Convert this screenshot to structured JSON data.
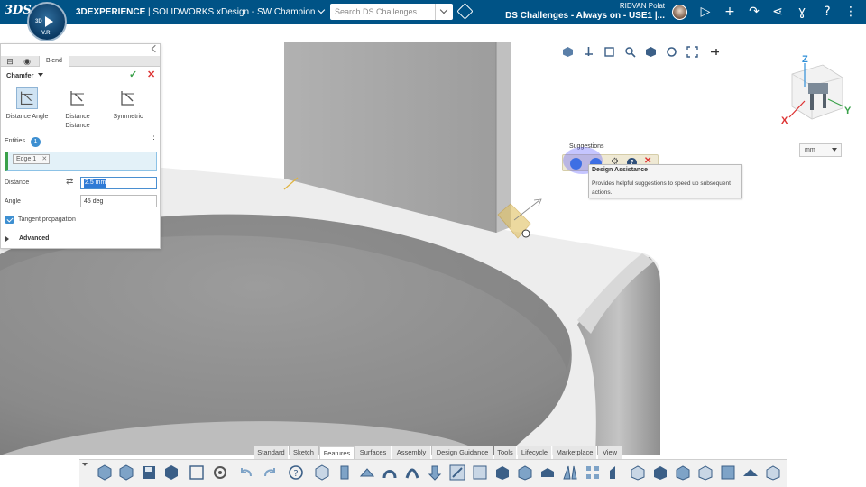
{
  "topbar": {
    "logo_text": "3DS",
    "compass_labels": [
      "3D",
      "V.R"
    ],
    "app_title_brand": "3DEXPERIENCE",
    "app_title_rest": " | SOLIDWORKS xDesign - SW Champion",
    "search_placeholder": "Search DS Challenges",
    "user_name": "RIDVAN Polat",
    "platform_title": "DS Challenges - Always on - USE1 |...",
    "icons": [
      "share-icon",
      "add-icon",
      "forward-icon",
      "network-icon",
      "compass-apps-icon",
      "help-icon",
      "more-icon"
    ]
  },
  "panel": {
    "tab_label": "Blend",
    "feature_name": "Chamfer",
    "types": [
      {
        "label": "Distance Angle",
        "selected": true
      },
      {
        "label": "Distance Distance",
        "selected": false
      },
      {
        "label": "Symmetric",
        "selected": false
      }
    ],
    "entities_label": "Entities",
    "entities_count": "1",
    "entity_chip": "Edge.1",
    "distance_label": "Distance",
    "distance_value": "2.5 mm",
    "angle_label": "Angle",
    "angle_value": "45 deg",
    "tangent_label": "Tangent propagation",
    "tangent_checked": true,
    "advanced_label": "Advanced"
  },
  "viewport": {
    "unit": "mm",
    "triad": {
      "x": "X",
      "y": "Y",
      "z": "Z"
    },
    "suggestions_label": "Suggestions",
    "tooltip_title": "Design Assistance",
    "tooltip_body": "Provides helpful suggestions to speed up subsequent actions.",
    "colors": {
      "part_shade": "#a9a9a9",
      "part_dark": "#8c8c8c",
      "selection": "#e0c060"
    }
  },
  "action_bar": {
    "tabs": [
      "Standard",
      "Sketch",
      "Features",
      "Surfaces",
      "Assembly",
      "Design Guidance",
      "Tools",
      "Lifecycle",
      "Marketplace",
      "View"
    ],
    "active_tab": "Features"
  }
}
